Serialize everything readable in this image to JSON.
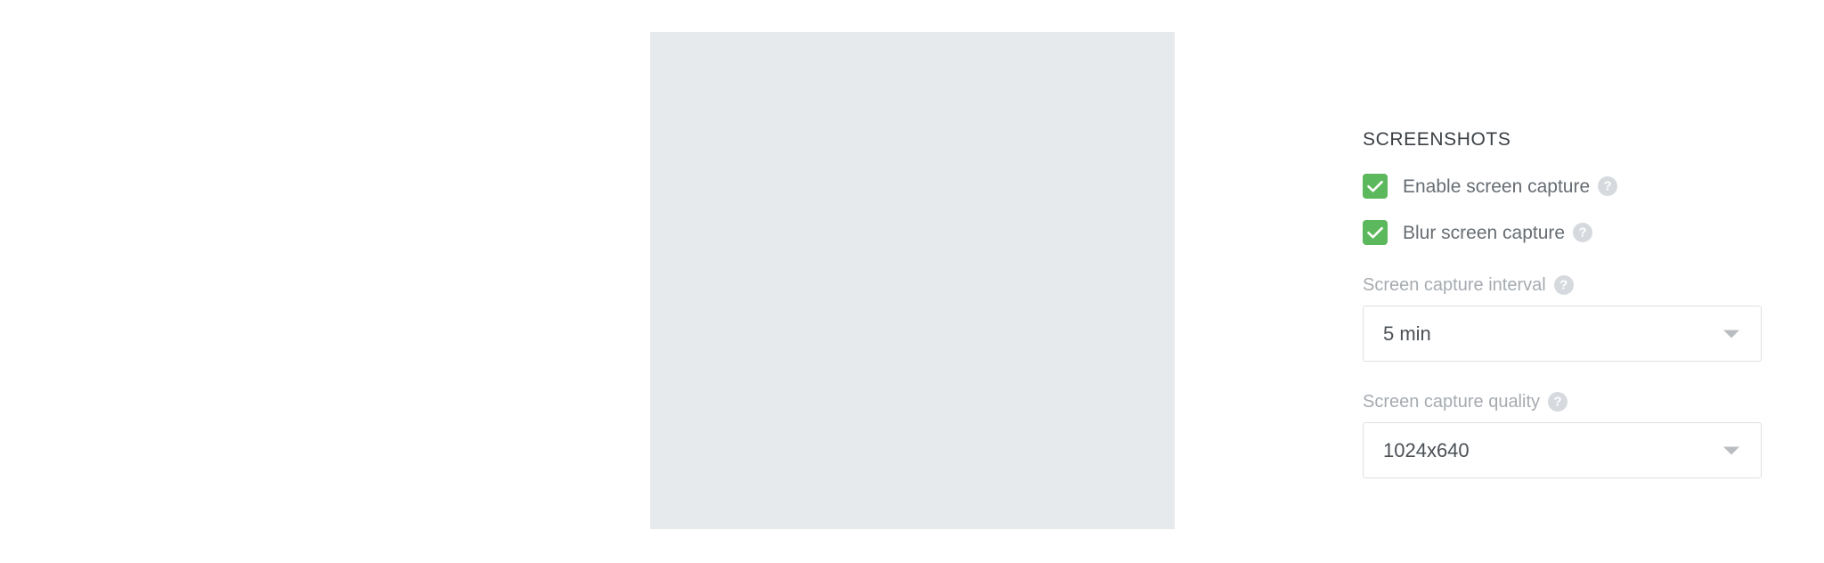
{
  "panel": {
    "section_title": "SCREENSHOTS",
    "checkboxes": [
      {
        "label": "Enable screen capture",
        "checked": true,
        "help": "?"
      },
      {
        "label": "Blur screen capture",
        "checked": true,
        "help": "?"
      }
    ],
    "fields": [
      {
        "label": "Screen capture interval",
        "help": "?",
        "value": "5 min",
        "caret": "chevron-down-icon"
      },
      {
        "label": "Screen capture quality",
        "help": "?",
        "value": "1024x640",
        "caret": "chevron-down-icon"
      }
    ]
  },
  "colors": {
    "checkbox_green": "#5cb85c",
    "panel_gray": "#e7eaec",
    "card_white": "#ffffff",
    "label_gray": "#a6abb0",
    "checkbox_label_gray": "#676d73",
    "title_gray": "#3b4045",
    "select_border": "#dcdfe2",
    "help_icon_gray": "#d6d9dd"
  }
}
